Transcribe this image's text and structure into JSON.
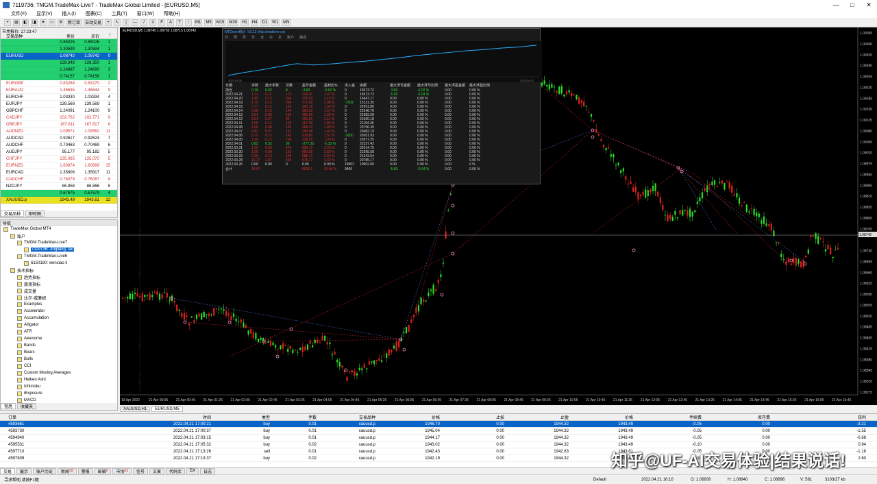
{
  "window": {
    "title": "7119736: TMGM.TradeMax-Live7 - TradeMax Global Limited - [EURUSD,M5]",
    "controls": [
      "—",
      "□",
      "✕"
    ]
  },
  "menu": [
    "文件(F)",
    "显示(V)",
    "插入(I)",
    "图表(C)",
    "工具(T)",
    "窗口(W)",
    "帮助(H)"
  ],
  "toolbar": {
    "new_order": "新订单",
    "auto_trade": "自动交易",
    "timeframes": [
      "M1",
      "M5",
      "M15",
      "M30",
      "H1",
      "H4",
      "D1",
      "W1",
      "MN"
    ]
  },
  "market_watch": {
    "title": "市场报价: 17:23:47",
    "headers": [
      "交易品种",
      "卖价",
      "买价",
      "!"
    ],
    "rows": [
      {
        "sym": "",
        "bid": "0.85025",
        "ask": "0.85026",
        "sp": "1",
        "bg": "#22d070"
      },
      {
        "sym": "",
        "bid": "1.30599",
        "ask": "1.30594",
        "sp": "1",
        "bg": "#22d070"
      },
      {
        "sym": "EURUSD",
        "bid": "1.08742",
        "ask": "1.08742",
        "sp": "0",
        "bg": "#0a64c8",
        "fg": "#fff"
      },
      {
        "sym": "",
        "bid": "128.346",
        "ask": "128.350",
        "sp": "1",
        "bg": "#22d070"
      },
      {
        "sym": "",
        "bid": "1.24887",
        "ask": "1.24890",
        "sp": "3",
        "bg": "#22d070"
      },
      {
        "sym": "",
        "bid": "0.74157",
        "ask": "0.74158",
        "sp": "1",
        "bg": "#22d070"
      },
      {
        "sym": "EURGBP",
        "bid": "0.83268",
        "ask": "0.83270",
        "sp": "2",
        "fg": "#d03030"
      },
      {
        "sym": "EURAUD",
        "bid": "1.46635",
        "ask": "1.46644",
        "sp": "9",
        "fg": "#d03030"
      },
      {
        "sym": "EURCHF",
        "bid": "1.03330",
        "ask": "1.03334",
        "sp": "4"
      },
      {
        "sym": "EURJPY",
        "bid": "139.568",
        "ask": "139.569",
        "sp": "1"
      },
      {
        "sym": "GBPCHF",
        "bid": "1.24091",
        "ask": "1.24100",
        "sp": "9"
      },
      {
        "sym": "CADJPY",
        "bid": "102.762",
        "ask": "102.771",
        "sp": "9",
        "fg": "#d03030"
      },
      {
        "sym": "GBPJPY",
        "bid": "167.611",
        "ask": "167.617",
        "sp": "6",
        "fg": "#d03030"
      },
      {
        "sym": "AUDNZD",
        "bid": "1.09571",
        "ask": "1.09582",
        "sp": "11",
        "fg": "#d03030"
      },
      {
        "sym": "AUDCAD",
        "bid": "0.92617",
        "ask": "0.92624",
        "sp": "7"
      },
      {
        "sym": "AUDCHF",
        "bid": "0.70463",
        "ask": "0.70469",
        "sp": "6"
      },
      {
        "sym": "AUDJPY",
        "bid": "95.177",
        "ask": "95.182",
        "sp": "5"
      },
      {
        "sym": "CHFJPY",
        "bid": "135.065",
        "ask": "135.070",
        "sp": "5",
        "fg": "#d03030"
      },
      {
        "sym": "EURNZD",
        "bid": "1.60674",
        "ask": "1.60689",
        "sp": "15",
        "fg": "#d03030"
      },
      {
        "sym": "EURCAD",
        "bid": "1.35806",
        "ask": "1.35817",
        "sp": "11"
      },
      {
        "sym": "CADCHF",
        "bid": "0.76079",
        "ask": "0.76087",
        "sp": "8",
        "fg": "#d03030"
      },
      {
        "sym": "NZDJPY",
        "bid": "86.858",
        "ask": "86.866",
        "sp": "8"
      },
      {
        "sym": "",
        "bid": "0.67675",
        "ask": "0.67679",
        "sp": "4",
        "bg": "#22d070"
      },
      {
        "sym": "XAUUSD.p",
        "bid": "1943.49",
        "ask": "1943.61",
        "sp": "12",
        "bg": "#e8e020"
      }
    ],
    "tabs": [
      "交易品种",
      "即时图"
    ]
  },
  "navigator": {
    "title": "导航",
    "items": [
      {
        "label": "TradeMax Global MT4",
        "indent": 0
      },
      {
        "label": "账户",
        "indent": 1
      },
      {
        "label": "TMGM.TradeMax-Live7",
        "indent": 2
      },
      {
        "label": "7119736: Jingliang Tao",
        "indent": 3,
        "sel": true
      },
      {
        "label": "TMGM.TradeMax-Live6",
        "indent": 2
      },
      {
        "label": "6150180: wenxiao li",
        "indent": 3
      },
      {
        "label": "技术指标",
        "indent": 1
      },
      {
        "label": "趋势指标",
        "indent": 2
      },
      {
        "label": "震荡指标",
        "indent": 2
      },
      {
        "label": "成交量",
        "indent": 2
      },
      {
        "label": "比尔·威廉姆",
        "indent": 2
      },
      {
        "label": "Examples",
        "indent": 2
      },
      {
        "label": "Accelerator",
        "indent": 2
      },
      {
        "label": "Accumulation",
        "indent": 2
      },
      {
        "label": "Alligator",
        "indent": 2
      },
      {
        "label": "ATR",
        "indent": 2
      },
      {
        "label": "Awesome",
        "indent": 2
      },
      {
        "label": "Bands",
        "indent": 2
      },
      {
        "label": "Bears",
        "indent": 2
      },
      {
        "label": "Bulls",
        "indent": 2
      },
      {
        "label": "CCI",
        "indent": 2
      },
      {
        "label": "Custom Moving Averages",
        "indent": 2
      },
      {
        "label": "Heiken Ashi",
        "indent": 2
      },
      {
        "label": "Ichimoku",
        "indent": 2
      },
      {
        "label": "iExposure",
        "indent": 2
      },
      {
        "label": "MACD",
        "indent": 2
      }
    ],
    "tabs": [
      "常用",
      "收藏夹"
    ]
  },
  "chart": {
    "info": "EURUSD,M5  1.08745 1.08755 1.08715 1.08742",
    "tabs": [
      "XAUUSD,H1",
      "EURUSD,M5"
    ],
    "time_labels": [
      "19 Apr 2022",
      "21 Apr 00:05",
      "21 Apr 00:45",
      "21 Apr 01:25",
      "21 Apr 02:05",
      "21 Apr 02:45",
      "21 Apr 03:25",
      "21 Apr 04:05",
      "21 Apr 04:45",
      "21 Apr 05:25",
      "21 Apr 06:05",
      "21 Apr 06:45",
      "21 Apr 07:25",
      "21 Apr 08:05",
      "21 Apr 08:45",
      "21 Apr 09:25",
      "21 Apr 10:05",
      "21 Apr 10:45",
      "21 Apr 11:25",
      "21 Apr 12:05",
      "21 Apr 12:45",
      "21 Apr 13:25",
      "21 Apr 14:05",
      "21 Apr 14:45",
      "21 Apr 15:25",
      "21 Apr 16:05",
      "21 Apr 16:45"
    ],
    "price_labels": [
      "1.09395",
      "1.09360",
      "1.09325",
      "1.09290",
      "1.09255",
      "1.09220",
      "1.09185",
      "1.09150",
      "1.09115",
      "1.09080",
      "1.09045",
      "1.09010",
      "1.08975",
      "1.08940",
      "1.08905",
      "1.08870",
      "1.08835",
      "1.08800",
      "1.08765",
      "1.08742",
      "1.08730",
      "1.08695",
      "1.08660",
      "1.08625",
      "1.08590",
      "1.08555",
      "1.08520",
      "1.08485",
      "1.08450",
      "1.08415",
      "1.08380",
      "1.08345",
      "1.08310",
      "1.08275"
    ],
    "current_price": "1.08742"
  },
  "stats_panel": {
    "title": "MTDriver统计 .V3.12 (http://mtdriver.cn)",
    "tabs": [
      "日",
      "周",
      "月",
      "年",
      "全",
      "价",
      "本",
      "账户",
      "路径"
    ],
    "graph_start": "2022.03.20",
    "graph_end": "2022.04.21",
    "headers": [
      "日期",
      "手数",
      "最大手数",
      "次数",
      "盈亏金额",
      "盈利比%",
      "出入金",
      "余额",
      "最大浮亏金额",
      "最大浮亏比例",
      "最大浮盈金额",
      "最大浮盈比例"
    ],
    "rows": [
      [
        "持仓",
        "0.18",
        "0.02",
        "8",
        "-3.82",
        "-0.02 %",
        "0",
        "15673.72",
        "-3.82",
        "-0.02 %",
        "0.00",
        "0.00 %"
      ],
      [
        "2022.04.21",
        "1.31",
        "0.11",
        "173",
        "226.51",
        "1.47 %",
        "0",
        "15673.72",
        "-5.83",
        "-0.04 %",
        "0.00",
        "0.00 %"
      ],
      [
        "2022.04.20",
        "1.95",
        "0.12",
        "354",
        "325.63",
        "2.15 %",
        "0",
        "15447.17",
        "0.00",
        "0.00 %",
        "0.00",
        "0.00 %"
      ],
      [
        "2022.04.19",
        "1.72",
        "0.12",
        "284",
        "271.56",
        "2.08 %",
        "-7502",
        "15121.35",
        "0.00",
        "0.00 %",
        "0.00",
        "0.00 %"
      ],
      [
        "2022.04.18",
        "0.77",
        "0.12",
        "102",
        "343.16",
        "1.54 %",
        "0",
        "22691.86",
        "0.00",
        "0.00 %",
        "0.00",
        "0.00 %"
      ],
      [
        "2022.04.14",
        "0.96",
        "0.12",
        "144",
        "350.50",
        "1.57 %",
        "0",
        "22348.70",
        "0.00",
        "0.00 %",
        "0.00",
        "0.00 %"
      ],
      [
        "2022.04.13",
        "1.01",
        "0.08",
        "153",
        "383.00",
        "1.69 %",
        "0",
        "21983.28",
        "0.00",
        "0.00 %",
        "0.00",
        "0.00 %"
      ],
      [
        "2022.04.12",
        "0.64",
        "0.07",
        "92",
        "465.91",
        "2.11 %",
        "0",
        "21660.18",
        "0.00",
        "0.00 %",
        "0.00",
        "0.00 %"
      ],
      [
        "2022.04.11",
        "1.05",
        "0.12",
        "129",
        "397.96",
        "1.86 %",
        "0",
        "21194.35",
        "0.00",
        "0.00 %",
        "0.00",
        "0.00 %"
      ],
      [
        "2022.04.08",
        "1.06",
        "0.08",
        "150",
        "368.33",
        "1.89 %",
        "0",
        "20796.39",
        "0.00",
        "0.00 %",
        "0.00",
        "0.00 %"
      ],
      [
        "2022.04.07",
        "0.82",
        "0.07",
        "131",
        "290.08",
        "1.42 %",
        "0",
        "20482.19",
        "0.00",
        "0.00 %",
        "0.00",
        "0.00 %"
      ],
      [
        "2022.04.06",
        "0.75",
        "0.12",
        "143",
        "318.80",
        "1.57 %",
        "-3000",
        "20201.93",
        "0.00",
        "0.00 %",
        "0.00",
        "0.00 %"
      ],
      [
        "2022.04.05",
        "1.20",
        "0.12",
        "138",
        "228.01",
        "1.00 %",
        "0",
        "22877.25",
        "0.00",
        "0.00 %",
        "0.00",
        "0.00 %"
      ],
      [
        "2022.04.01",
        "0.82",
        "0.32",
        "30",
        "-277.33",
        "-1.23 %",
        "0",
        "22337.42",
        "0.00",
        "0.00 %",
        "0.00",
        "0.00 %"
      ],
      [
        "2022.03.31",
        "1.20",
        "0.09",
        "270",
        "620.17",
        "2.29 %",
        "0",
        "22614.75",
        "0.00",
        "0.00 %",
        "0.00",
        "0.00 %"
      ],
      [
        "2022.03.30",
        "1.56",
        "0.08",
        "163",
        "693.58",
        "2.65 %",
        "0",
        "21995.58",
        "0.00",
        "0.00 %",
        "0.00",
        "0.00 %"
      ],
      [
        "2022.03.29",
        "0.99",
        "0.12",
        "166",
        "588.17",
        "2.84 %",
        "0",
        "21343.54",
        "0.00",
        "0.00 %",
        "0.00",
        "0.00 %"
      ],
      [
        "2022.03.28",
        "10.17",
        "1.07",
        "493",
        "675.17",
        "3.32 %",
        "0",
        "20785.17",
        "0.00",
        "0.00 %",
        "0.00",
        "0.00 %"
      ],
      [
        "2022.03.26",
        "0.00",
        "0.00",
        "0",
        "0.00",
        "0.00 %",
        "19902",
        "19902.00",
        "0.00",
        "0.00 %",
        "0.00",
        "0 %"
      ],
      [
        "合计",
        "19.97",
        "",
        "",
        "6639.1",
        "33.84 %",
        "9400",
        "",
        "-5.83",
        "-0.04 %",
        "0.00",
        "0.00 %"
      ]
    ]
  },
  "terminal": {
    "headers": [
      "订单",
      "时间",
      "类型",
      "手数",
      "交易品种",
      "价格",
      "止损",
      "止盈",
      "价格",
      "手续费",
      "库存费",
      "获利"
    ],
    "rows": [
      [
        "4593661",
        "2022.04.21 17:00:21",
        "buy",
        "0.01",
        "xauusd.p",
        "1946.70",
        "0.00",
        "1944.32",
        "1943.49",
        "-0.05",
        "0.00",
        "-3.21"
      ],
      [
        "4593730",
        "2022.04.21 17:00:37",
        "buy",
        "0.01",
        "xauusd.p",
        "1945.04",
        "0.00",
        "1944.32",
        "1943.49",
        "-0.05",
        "0.00",
        "-1.55"
      ],
      [
        "4594940",
        "2022.04.21 17:03:15",
        "buy",
        "0.01",
        "xauusd.p",
        "1944.17",
        "0.00",
        "1944.32",
        "1943.49",
        "-0.05",
        "0.00",
        "-0.68"
      ],
      [
        "4595531",
        "2022.04.21 17:05:32",
        "buy",
        "0.02",
        "xauusd.p",
        "1943.02",
        "0.00",
        "1944.32",
        "1943.49",
        "-0.10",
        "0.00",
        "0.94"
      ],
      [
        "4597710",
        "2022.04.21 17:13:26",
        "sell",
        "0.01",
        "xauusd.p",
        "1942.43",
        "0.00",
        "1942.63",
        "1943.61",
        "-0.05",
        "0.00",
        "-1.18"
      ],
      [
        "4597809",
        "2022.04.21 17:13:37",
        "buy",
        "0.02",
        "xauusd.p",
        "1942.19",
        "0.00",
        "1944.32",
        "1943.49",
        "-0.10",
        "0.00",
        "2.60"
      ]
    ],
    "tabs": [
      "交易",
      "展示",
      "账户历史",
      "新闻",
      "警报",
      "邮箱",
      "市场",
      "信号",
      "文章",
      "代码库",
      "EA",
      "日志"
    ],
    "tab_badges": {
      "新闻": "99",
      "邮箱": "6",
      "市场": "63"
    }
  },
  "statusbar": {
    "help": "寻求帮助,请按F1键",
    "profile": "Default",
    "time": "2022.04.21 16:10",
    "open": "O: 1.08930",
    "high": "H: 1.08940",
    "close": "C: 1.08896",
    "volume": "V: 581",
    "traffic": "3103/27 kb"
  },
  "watermark": "知乎@UF-AI交易体验|结果说话!",
  "colors": {
    "bull": "#28e028",
    "bear": "#e02020",
    "chart_bg": "#000000",
    "selection": "#0a64c8"
  }
}
